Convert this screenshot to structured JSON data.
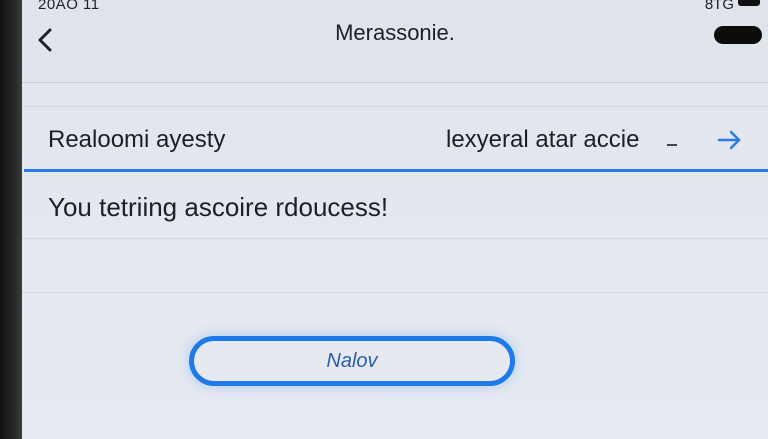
{
  "status_bar": {
    "time": "20AO 11",
    "right_text": "8TG"
  },
  "nav": {
    "title": "Merassonie."
  },
  "row": {
    "left_label": "Realoomi ayesty",
    "right_label": "lexyeral atar accie",
    "right_dash": "-"
  },
  "message": {
    "text": "You tetriing ascoire rdoucess!"
  },
  "button": {
    "label": "Nalov"
  },
  "colors": {
    "accent": "#1d7ae8",
    "screen_bg": "#e3e7ee",
    "text": "#1d2024"
  },
  "icons": {
    "back": "chevron-left-icon",
    "arrow": "arrow-right-icon",
    "battery": "battery-icon"
  }
}
